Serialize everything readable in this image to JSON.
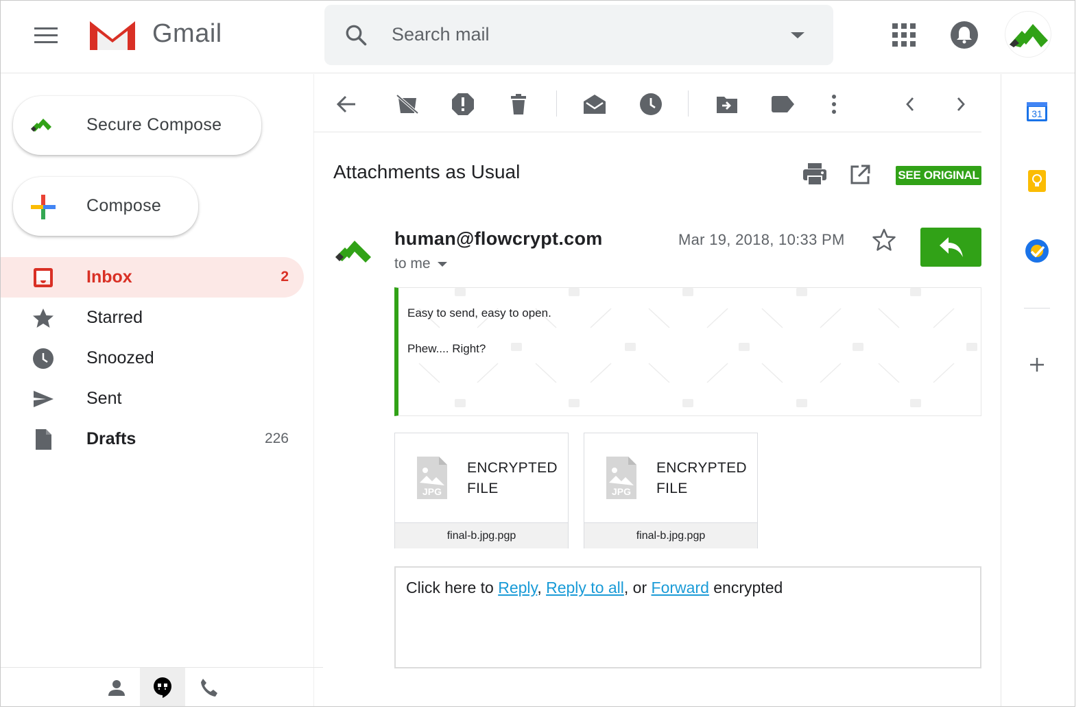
{
  "app": {
    "name": "Gmail",
    "brand_colors": {
      "gmail_red": "#d93025",
      "flowcrypt_green": "#31a217"
    }
  },
  "header": {
    "search_placeholder": "Search mail"
  },
  "sidebar": {
    "secure_compose_label": "Secure Compose",
    "compose_label": "Compose",
    "items": [
      {
        "label": "Inbox",
        "count": "2",
        "icon": "inbox-icon"
      },
      {
        "label": "Starred",
        "count": "",
        "icon": "star-icon"
      },
      {
        "label": "Snoozed",
        "count": "",
        "icon": "clock-icon"
      },
      {
        "label": "Sent",
        "count": "",
        "icon": "send-icon"
      },
      {
        "label": "Drafts",
        "count": "226",
        "icon": "draft-icon"
      }
    ]
  },
  "message": {
    "subject": "Attachments as Usual",
    "see_original_label": "SEE ORIGINAL",
    "sender": "human@flowcrypt.com",
    "recipient": "to me",
    "date": "Mar 19, 2018, 10:33 PM",
    "body_lines": [
      "Easy to send, easy to open.",
      "Phew.... Right?"
    ],
    "attachments": [
      {
        "type_label_1": "ENCRYPTED",
        "type_label_2": "FILE",
        "filename": "final-b.jpg.pgp",
        "icon_text": "JPG"
      },
      {
        "type_label_1": "ENCRYPTED",
        "type_label_2": "FILE",
        "filename": "final-b.jpg.pgp",
        "icon_text": "JPG"
      }
    ],
    "reply_box": {
      "prefix": "Click here to ",
      "reply": "Reply",
      "sep1": ", ",
      "reply_all": "Reply to all",
      "sep2": ", or ",
      "forward": "Forward",
      "suffix": " encrypted"
    }
  },
  "side_panel": {
    "calendar_day": "31"
  }
}
